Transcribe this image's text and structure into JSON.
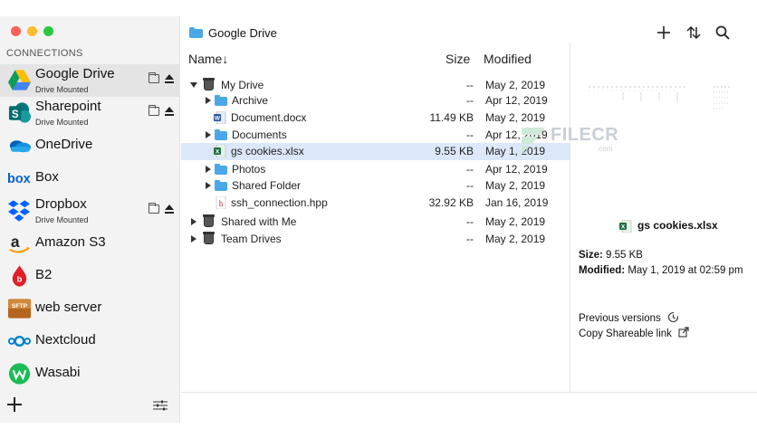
{
  "sidebar": {
    "section_title": "CONNECTIONS",
    "items": [
      {
        "label": "Google Drive",
        "sub": "Drive Mounted",
        "icon": "google-drive-icon"
      },
      {
        "label": "Sharepoint",
        "sub": "Drive Mounted",
        "icon": "sharepoint-icon"
      },
      {
        "label": "OneDrive",
        "sub": "",
        "icon": "onedrive-icon"
      },
      {
        "label": "Box",
        "sub": "",
        "icon": "box-icon"
      },
      {
        "label": "Dropbox",
        "sub": "Drive Mounted",
        "icon": "dropbox-icon"
      },
      {
        "label": "Amazon S3",
        "sub": "",
        "icon": "amazon-icon"
      },
      {
        "label": "B2",
        "sub": "",
        "icon": "b2-icon"
      },
      {
        "label": "web server",
        "sub": "",
        "icon": "sftp-icon"
      },
      {
        "label": "Nextcloud",
        "sub": "",
        "icon": "nextcloud-icon"
      },
      {
        "label": "Wasabi",
        "sub": "",
        "icon": "wasabi-icon"
      }
    ]
  },
  "header": {
    "location": "Google Drive"
  },
  "columns": {
    "name": "Name↓",
    "size": "Size",
    "modified": "Modified"
  },
  "files": [
    {
      "name": "My Drive",
      "size": "--",
      "modified": "May 2, 2019",
      "type": "drive"
    },
    {
      "name": "Archive",
      "size": "--",
      "modified": "Apr 12, 2019",
      "type": "folder"
    },
    {
      "name": "Document.docx",
      "size": "11.49 KB",
      "modified": "May 2, 2019",
      "type": "docx"
    },
    {
      "name": "Documents",
      "size": "--",
      "modified": "Apr 12, 2019",
      "type": "folder"
    },
    {
      "name": "gs cookies.xlsx",
      "size": "9.55 KB",
      "modified": "May 1, 2019",
      "type": "xlsx"
    },
    {
      "name": "Photos",
      "size": "--",
      "modified": "Apr 12, 2019",
      "type": "folder"
    },
    {
      "name": "Shared Folder",
      "size": "--",
      "modified": "May 2, 2019",
      "type": "folder"
    },
    {
      "name": "ssh_connection.hpp",
      "size": "32.92 KB",
      "modified": "Jan 16, 2019",
      "type": "hpp"
    },
    {
      "name": "Shared with Me",
      "size": "--",
      "modified": "May 2, 2019",
      "type": "drive"
    },
    {
      "name": "Team Drives",
      "size": "--",
      "modified": "May 2, 2019",
      "type": "drive"
    }
  ],
  "preview": {
    "file_name": "gs cookies.xlsx",
    "size_label": "Size:",
    "size_value": "9.55 KB",
    "modified_label": "Modified:",
    "modified_value": "May 1, 2019 at 02:59 pm",
    "previous_versions": "Previous versions",
    "copy_link": "Copy Shareable link"
  },
  "watermark": {
    "text": "FILECR",
    "sub": ".com"
  },
  "colors": {
    "selection": "#dce8fa",
    "folder": "#4aa8e8",
    "sidebar_bg": "#f3f3f3"
  }
}
